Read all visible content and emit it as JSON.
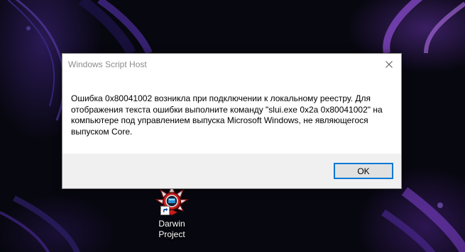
{
  "dialog": {
    "title": "Windows Script Host",
    "message": "Ошибка 0x80041002 возникла при подключении к локальному реестру. Для отображения текста ошибки выполните команду \"slui.exe 0x2a 0x80041002\" на компьютере под управлением выпуска Microsoft Windows, не являющегося выпуском Core.",
    "ok_label": "OK",
    "close_icon": "close-icon",
    "accent_color": "#0078d7"
  },
  "desktop": {
    "icons": [
      {
        "label": "Darwin\nProject",
        "icon": "darwin-project-app-icon",
        "shortcut_overlay": "shortcut-arrow-icon"
      }
    ]
  }
}
